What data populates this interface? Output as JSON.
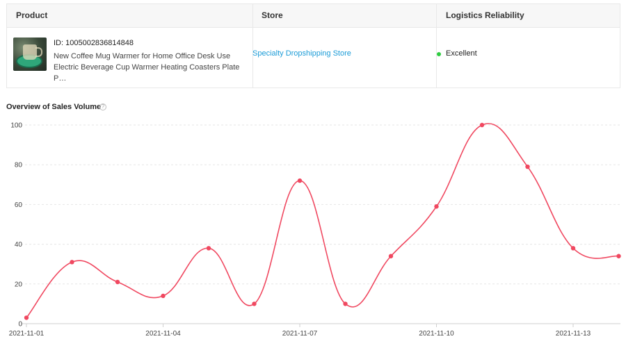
{
  "table": {
    "headers": {
      "product": "Product",
      "store": "Store",
      "logistics": "Logistics Reliability"
    },
    "row": {
      "product_id": "ID: 1005002836814848",
      "product_title": "New Coffee Mug Warmer for Home Office Desk Use Electric Beverage Cup Warmer Heating Coasters Plate P…",
      "store_name": "Specialty Dropshipping Store",
      "logistics_status": "Excellent",
      "logistics_color": "#2ecc40"
    }
  },
  "section": {
    "title": "Overview of Sales Volume",
    "help_icon": "?"
  },
  "chart_data": {
    "type": "line",
    "title": "Overview of Sales Volume",
    "x": [
      "2021-11-01",
      "2021-11-02",
      "2021-11-03",
      "2021-11-04",
      "2021-11-05",
      "2021-11-06",
      "2021-11-07",
      "2021-11-08",
      "2021-11-09",
      "2021-11-10",
      "2021-11-11",
      "2021-11-12",
      "2021-11-13",
      "2021-11-14"
    ],
    "x_tick_labels": [
      "2021-11-01",
      "2021-11-04",
      "2021-11-07",
      "2021-11-10",
      "2021-11-13"
    ],
    "series": [
      {
        "values": [
          3,
          31,
          21,
          14,
          38,
          10,
          72,
          10,
          34,
          59,
          100,
          79,
          38,
          34
        ],
        "color": "#f04860"
      }
    ],
    "yticks": [
      0,
      20,
      40,
      60,
      80,
      100
    ],
    "ylim": [
      0,
      100
    ],
    "grid": true,
    "smooth": true
  }
}
